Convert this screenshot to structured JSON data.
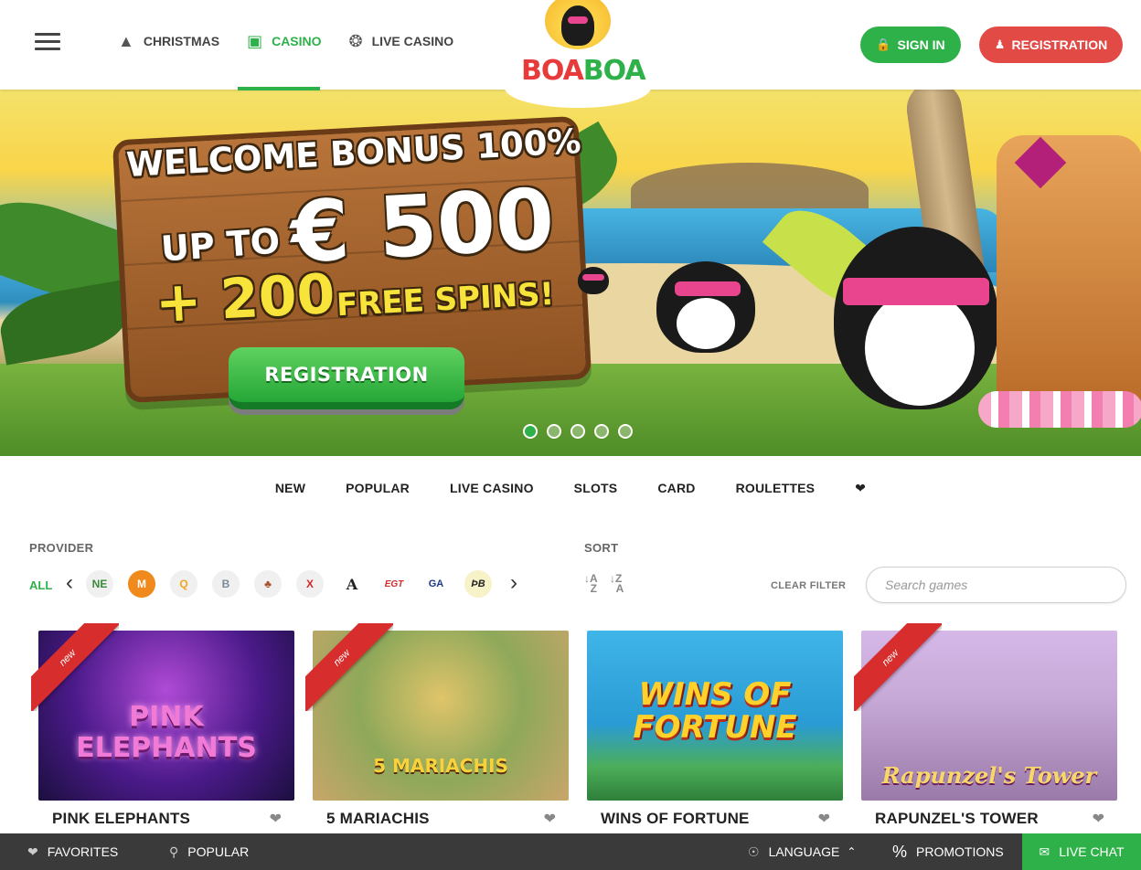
{
  "header": {
    "menu_icon": "hamburger-icon",
    "nav": [
      {
        "label": "CHRISTMAS",
        "icon": "tree-icon",
        "active": false
      },
      {
        "label": "CASINO",
        "icon": "dice-icon",
        "active": true
      },
      {
        "label": "LIVE CASINO",
        "icon": "roulette-icon",
        "active": false
      }
    ],
    "logo": {
      "part1": "BOA",
      "part2": "BOA"
    },
    "signin_label": "SIGN IN",
    "registration_label": "REGISTRATION",
    "colors": {
      "green": "#2fb14a",
      "red": "#e24a46"
    }
  },
  "hero": {
    "line1": "WELCOME BONUS 100%",
    "line2": "UP TO",
    "amount": "€ 500",
    "line3": "+ 200",
    "line4": "FREE SPINS!",
    "cta": "REGISTRATION",
    "slides": 5,
    "active_slide": 1
  },
  "categories": [
    "NEW",
    "POPULAR",
    "LIVE CASINO",
    "SLOTS",
    "CARD",
    "ROULETTES"
  ],
  "categories_fav_icon": "heart-icon",
  "filters": {
    "provider_label": "PROVIDER",
    "all_label": "ALL",
    "providers": [
      {
        "name": "netent-logo",
        "glyph": "NE"
      },
      {
        "name": "microgaming-logo",
        "glyph": "M"
      },
      {
        "name": "quickspin-logo",
        "glyph": "Q"
      },
      {
        "name": "betsoft-logo",
        "glyph": "B"
      },
      {
        "name": "tree-logo",
        "glyph": "♣"
      },
      {
        "name": "x-logo",
        "glyph": "X"
      },
      {
        "name": "a-logo",
        "glyph": "A"
      },
      {
        "name": "egt-logo",
        "glyph": "EGT"
      },
      {
        "name": "ga-logo",
        "glyph": "GA"
      },
      {
        "name": "db-logo",
        "glyph": "ÞB"
      }
    ],
    "sort_label": "SORT",
    "clear_filter": "CLEAR FILTER",
    "search_placeholder": "Search games"
  },
  "games": [
    {
      "name": "PINK ELEPHANTS",
      "thumb_title": "PINK ELEPHANTS",
      "is_new": true,
      "new_label": "new"
    },
    {
      "name": "5 MARIACHIS",
      "thumb_title": "5 MARIACHIS",
      "is_new": true,
      "new_label": "new"
    },
    {
      "name": "WINS OF FORTUNE",
      "thumb_title": "WINS OF FORTUNE",
      "is_new": false,
      "new_label": ""
    },
    {
      "name": "RAPUNZEL'S TOWER",
      "thumb_title": "Rapunzel's Tower",
      "is_new": true,
      "new_label": "new"
    }
  ],
  "bottombar": {
    "favorites": "FAVORITES",
    "popular": "POPULAR",
    "language": "LANGUAGE",
    "promotions": "PROMOTIONS",
    "livechat": "LIVE CHAT"
  }
}
